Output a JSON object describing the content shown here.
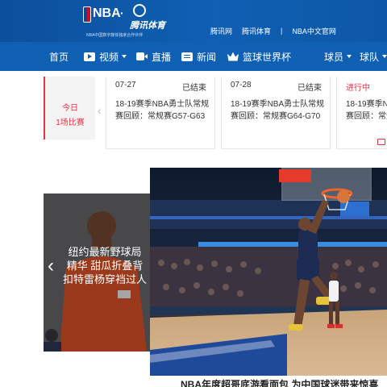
{
  "header": {
    "logo": {
      "nba_text": "NBA",
      "dot": "·",
      "tencent_sports": "腾讯体育",
      "partner_line": "NBA中国数字媒体独家合作伙伴"
    },
    "links": [
      "腾讯网",
      "腾讯体育",
      "|",
      "NBA中文官网"
    ]
  },
  "nav": {
    "items": [
      {
        "label": "首页",
        "icon": "",
        "caret": false
      },
      {
        "label": "视频",
        "icon": "video-icon",
        "caret": true
      },
      {
        "label": "直播",
        "icon": "live-icon",
        "caret": false
      },
      {
        "label": "新闻",
        "icon": "news-icon",
        "caret": false
      },
      {
        "label": "篮球世界杯",
        "icon": "crown-icon",
        "caret": false
      },
      {
        "label": "球员",
        "icon": "",
        "caret": true
      },
      {
        "label": "球队",
        "icon": "",
        "caret": true
      }
    ]
  },
  "schedule": {
    "today_label": "今日",
    "today_count": "1场比赛",
    "prev_arrow": "‹",
    "games": [
      {
        "date": "07-27",
        "status": "已结束",
        "title_line1": "18-19赛季NBA勇士队常规",
        "title_line2": "赛回顾：常规赛G57-G63"
      },
      {
        "date": "07-28",
        "status": "已结束",
        "title_line1": "18-19赛季NBA勇士队常规",
        "title_line2": "赛回顾：常规赛G64-G70"
      },
      {
        "date": "",
        "status": "进行中",
        "title_line1": "18-19赛季NBA",
        "title_line2": "赛回顾：常规"
      }
    ]
  },
  "feature": {
    "side_title": "纽约最新野球局 精华 甜瓜折叠背扣特雷杨穿裆过人",
    "prev_arrow": "‹",
    "headline": "NBA年度超哥底游看面包 为中国球迷带来惊喜"
  },
  "colors": {
    "header_blue": "#0c4f9c",
    "nav_blue": "#0f5fb3",
    "accent_red": "#e8334a"
  }
}
